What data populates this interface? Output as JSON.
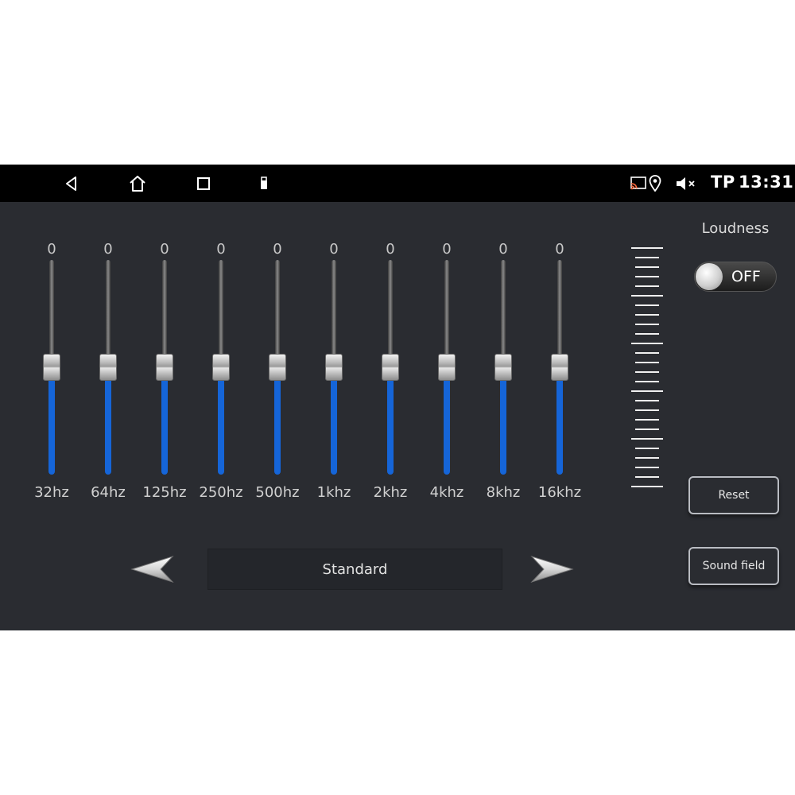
{
  "status_bar": {
    "carrier": "TP",
    "time": "13:31",
    "icons": [
      "back-icon",
      "home-icon",
      "recents-icon",
      "usb-icon",
      "cast-icon",
      "location-icon",
      "volume-muted-icon"
    ]
  },
  "equalizer": {
    "bands": [
      {
        "freq": "32hz",
        "value": "0",
        "level": 0.5
      },
      {
        "freq": "64hz",
        "value": "0",
        "level": 0.5
      },
      {
        "freq": "125hz",
        "value": "0",
        "level": 0.5
      },
      {
        "freq": "250hz",
        "value": "0",
        "level": 0.5
      },
      {
        "freq": "500hz",
        "value": "0",
        "level": 0.5
      },
      {
        "freq": "1khz",
        "value": "0",
        "level": 0.5
      },
      {
        "freq": "2khz",
        "value": "0",
        "level": 0.5
      },
      {
        "freq": "4khz",
        "value": "0",
        "level": 0.5
      },
      {
        "freq": "8khz",
        "value": "0",
        "level": 0.5
      },
      {
        "freq": "16khz",
        "value": "0",
        "level": 0.5
      }
    ]
  },
  "loudness": {
    "label": "Loudness",
    "state": "OFF"
  },
  "buttons": {
    "reset": "Reset",
    "sound_field": "Sound field"
  },
  "preset": {
    "name": "Standard"
  },
  "colors": {
    "accent": "#1565d8",
    "background": "#2a2c31",
    "status_bar": "#000000"
  }
}
